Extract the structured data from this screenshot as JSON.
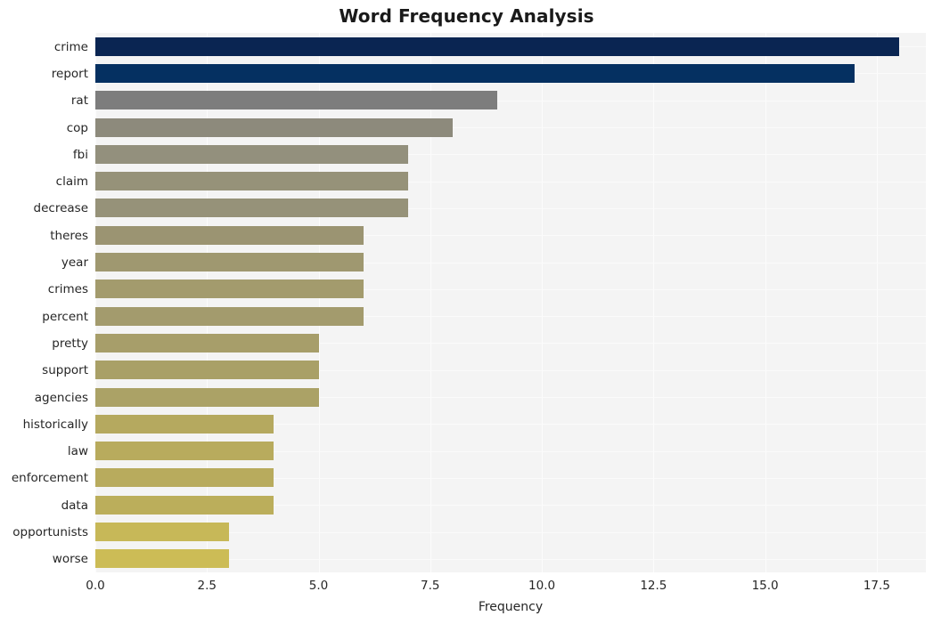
{
  "chart_data": {
    "type": "bar",
    "orientation": "horizontal",
    "title": "Word Frequency Analysis",
    "xlabel": "Frequency",
    "ylabel": "",
    "xlim": [
      0,
      18.6
    ],
    "ylim_categories_top_to_bottom": true,
    "grid": true,
    "legend": null,
    "xticks": [
      "0.0",
      "2.5",
      "5.0",
      "7.5",
      "10.0",
      "12.5",
      "15.0",
      "17.5"
    ],
    "xtick_values": [
      0.0,
      2.5,
      5.0,
      7.5,
      10.0,
      12.5,
      15.0,
      17.5
    ],
    "categories": [
      "crime",
      "report",
      "rat",
      "cop",
      "fbi",
      "claim",
      "decrease",
      "theres",
      "year",
      "crimes",
      "percent",
      "pretty",
      "support",
      "agencies",
      "historically",
      "law",
      "enforcement",
      "data",
      "opportunists",
      "worse"
    ],
    "values": [
      18,
      17,
      9,
      8,
      7,
      7,
      7,
      6,
      6,
      6,
      6,
      5,
      5,
      5,
      4,
      4,
      4,
      4,
      3,
      3
    ],
    "bar_colors": [
      "#0a2552",
      "#053061",
      "#7d7d7d",
      "#8d8a7c",
      "#93907d",
      "#969279",
      "#969279",
      "#9b9472",
      "#9f9870",
      "#a39b6d",
      "#a39b6d",
      "#a79e6a",
      "#a9a067",
      "#aba266",
      "#b5a95f",
      "#b8ab5d",
      "#b8ab5d",
      "#bbae5b",
      "#c7b858",
      "#ccbc56"
    ],
    "colormap": "cividis-like sequential navy-to-gold",
    "plot_background": "#f4f4f4",
    "gridline_color": "#fcfcfc",
    "text_color": "#262626"
  }
}
